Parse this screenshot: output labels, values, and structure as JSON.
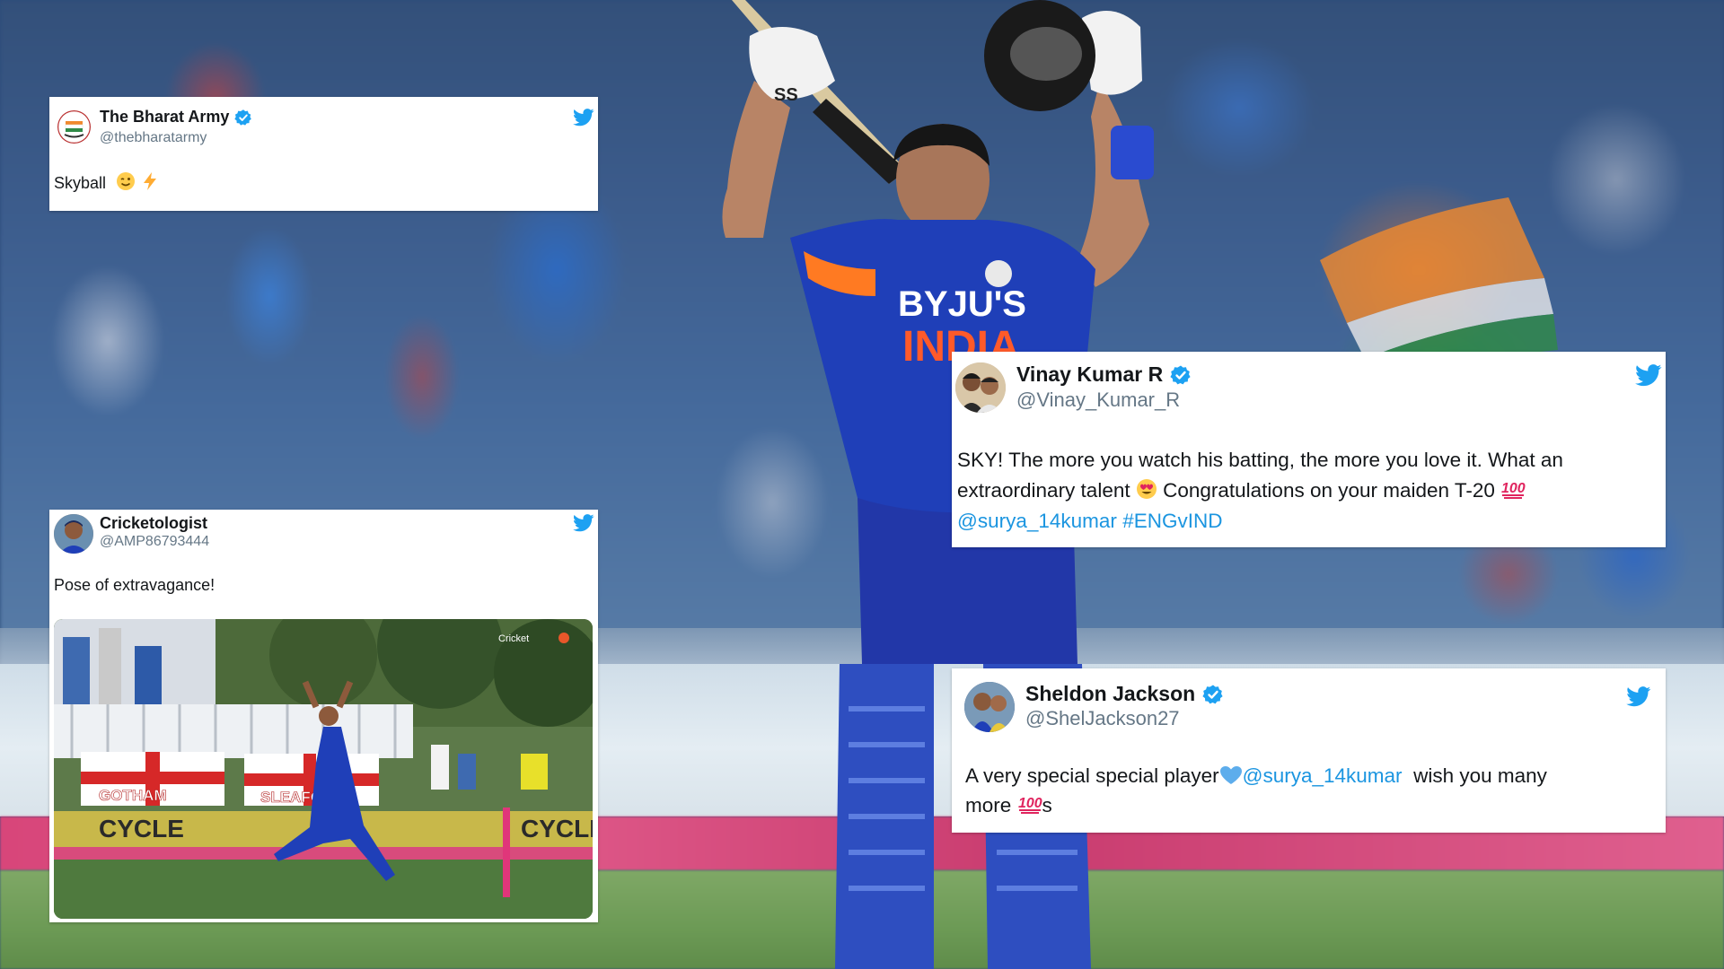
{
  "tweets": [
    {
      "name": "The Bharat Army",
      "handle": "@thebharatarmy",
      "verified": true,
      "text": "Skyball",
      "emojis": [
        "wink-emoji",
        "lightning-emoji"
      ]
    },
    {
      "name": "Cricketologist",
      "handle": "@AMP86793444",
      "verified": false,
      "text": "Pose of extravagance!",
      "media": {
        "watermark": "Cricket",
        "boards": [
          "GOTHAM",
          "SLEAFO"
        ],
        "sponsor": "CYCLE"
      }
    },
    {
      "name": "Vinay Kumar R",
      "handle": "@Vinay_Kumar_R",
      "verified": true,
      "text_line1": "SKY! The more you watch his batting, the more you love it. What an",
      "text_line2a": "extraordinary talent ",
      "text_line2b": " Congratulations on your maiden T-20 ",
      "mention": "@surya_14kumar",
      "hashtag": "#ENGvIND"
    },
    {
      "name": "Sheldon Jackson",
      "handle": "@ShelJackson27",
      "verified": true,
      "text_a": "A very special special player",
      "mention": "@surya_14kumar",
      "text_b": "  wish you many",
      "text_c": "more ",
      "text_d": "s"
    }
  ],
  "photo": {
    "jersey_sponsor": "BYJU'S",
    "jersey_team": "INDIA",
    "helmet_brand": "SS"
  },
  "colors": {
    "twitter_blue": "#1da1f2",
    "verified_blue": "#1da1f2",
    "mention_blue": "#1b95e0",
    "jersey_blue": "#1f3fb8"
  }
}
